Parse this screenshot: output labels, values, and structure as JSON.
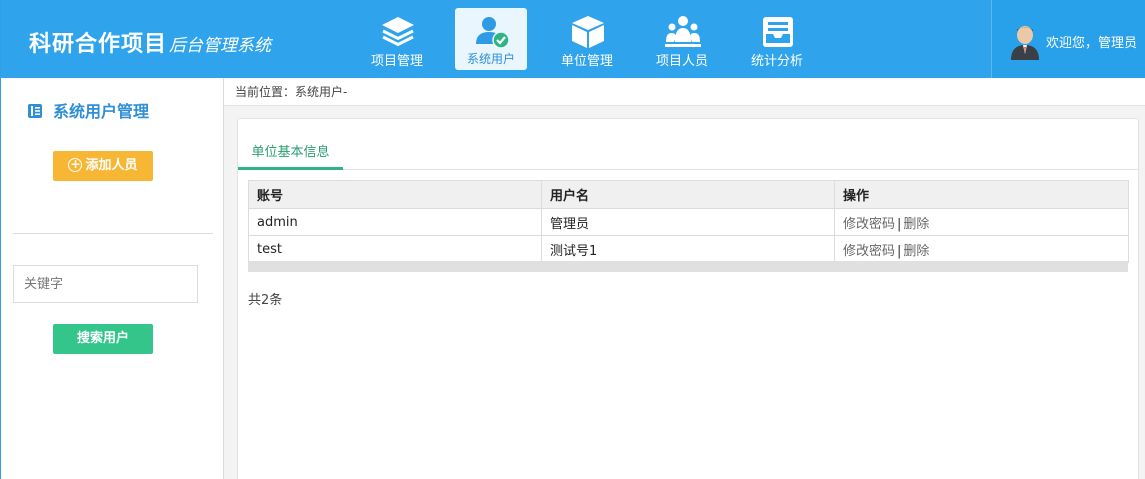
{
  "brand": {
    "title": "科研合作项目",
    "subtitle": "后台管理系统"
  },
  "nav": {
    "items": [
      {
        "label": "项目管理",
        "icon": "layers-icon",
        "active": false
      },
      {
        "label": "系统用户",
        "icon": "user-check-icon",
        "active": true
      },
      {
        "label": "单位管理",
        "icon": "box-icon",
        "active": false
      },
      {
        "label": "项目人员",
        "icon": "people-icon",
        "active": false
      },
      {
        "label": "统计分析",
        "icon": "tray-icon",
        "active": false
      }
    ]
  },
  "welcome": {
    "text": "欢迎您，管理员",
    "avatar_icon": "user-avatar-icon"
  },
  "sidebar": {
    "title": "系统用户管理",
    "add_button": "添加人员",
    "keyword_placeholder": "关键字",
    "search_button": "搜索用户"
  },
  "breadcrumb": "当前位置：系统用户-",
  "tab": "单位基本信息",
  "table": {
    "headers": [
      "账号",
      "用户名",
      "操作"
    ],
    "rows": [
      {
        "account": "admin",
        "username": "管理员",
        "op_edit": "修改密码",
        "op_sep": "|",
        "op_delete": "删除"
      },
      {
        "account": "test",
        "username": "测试号1",
        "op_edit": "修改密码",
        "op_sep": "|",
        "op_delete": "删除"
      }
    ]
  },
  "total": "共2条",
  "colors": {
    "header_bg": "#2fa4ec",
    "active_nav_bg": "#eaf6fd",
    "add_button": "#f7b734",
    "search_button": "#33c58a",
    "tab_accent": "#2fb584",
    "sidebar_title": "#2f8fd6"
  }
}
